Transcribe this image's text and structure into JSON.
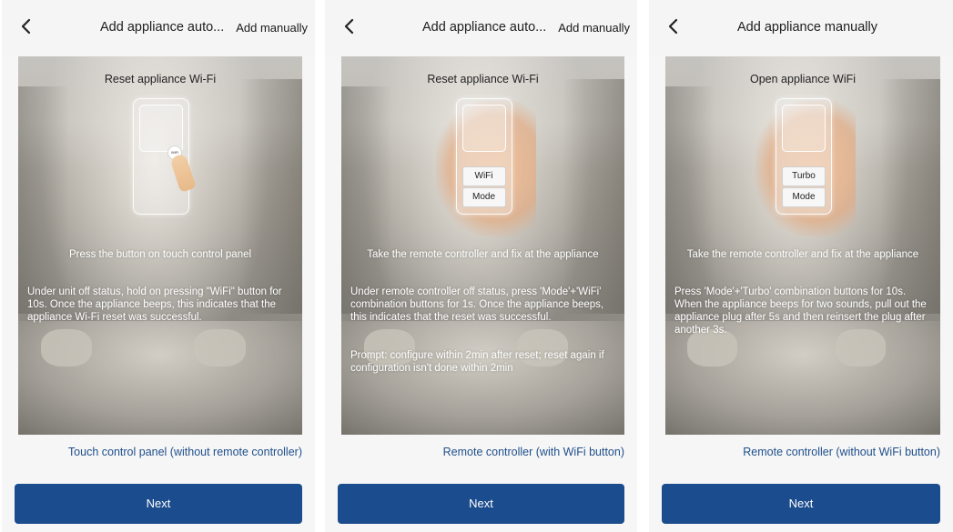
{
  "colors": {
    "accent": "#1b4c8d",
    "link": "#1f4f8b",
    "background": "#f6f6f6"
  },
  "panels": [
    {
      "back_icon": "chevron-left-icon",
      "title": "Add appliance auto...",
      "action": "Add manually",
      "illustration_title": "Reset appliance Wi-Fi",
      "device_buttons": [],
      "touch_label": "WiFi",
      "caption": "Press the button on touch control panel",
      "description": "Under unit off status, hold on pressing \"WiFi\" button for 10s. Once the appliance beeps, this indicates that the appliance Wi-Fi reset was successful.",
      "prompt": "",
      "mode_link": "Touch control panel (without remote controller)",
      "next": "Next"
    },
    {
      "back_icon": "chevron-left-icon",
      "title": "Add appliance auto...",
      "action": "Add manually",
      "illustration_title": "Reset appliance Wi-Fi",
      "device_buttons": [
        "WiFi",
        "Mode"
      ],
      "caption": "Take the remote controller and fix at the appliance",
      "description": "Under remote controller off status, press 'Mode'+'WiFi' combination buttons for 1s. Once the appliance beeps, this indicates that the reset was successful.",
      "prompt": "Prompt: configure within 2min after reset; reset again if configuration isn't done within 2min",
      "mode_link": "Remote controller (with WiFi button)",
      "next": "Next"
    },
    {
      "back_icon": "chevron-left-icon",
      "title": "Add appliance manually",
      "action": "",
      "illustration_title": "Open appliance WiFi",
      "device_buttons": [
        "Turbo",
        "Mode"
      ],
      "caption": "Take the remote controller and fix at the appliance",
      "description": "Press 'Mode'+'Turbo' combination buttons for 10s. When the appliance beeps for two sounds, pull out the appliance plug after 5s and then reinsert the plug after another 3s.",
      "prompt": "",
      "mode_link": "Remote controller (without WiFi button)",
      "next": "Next"
    }
  ]
}
